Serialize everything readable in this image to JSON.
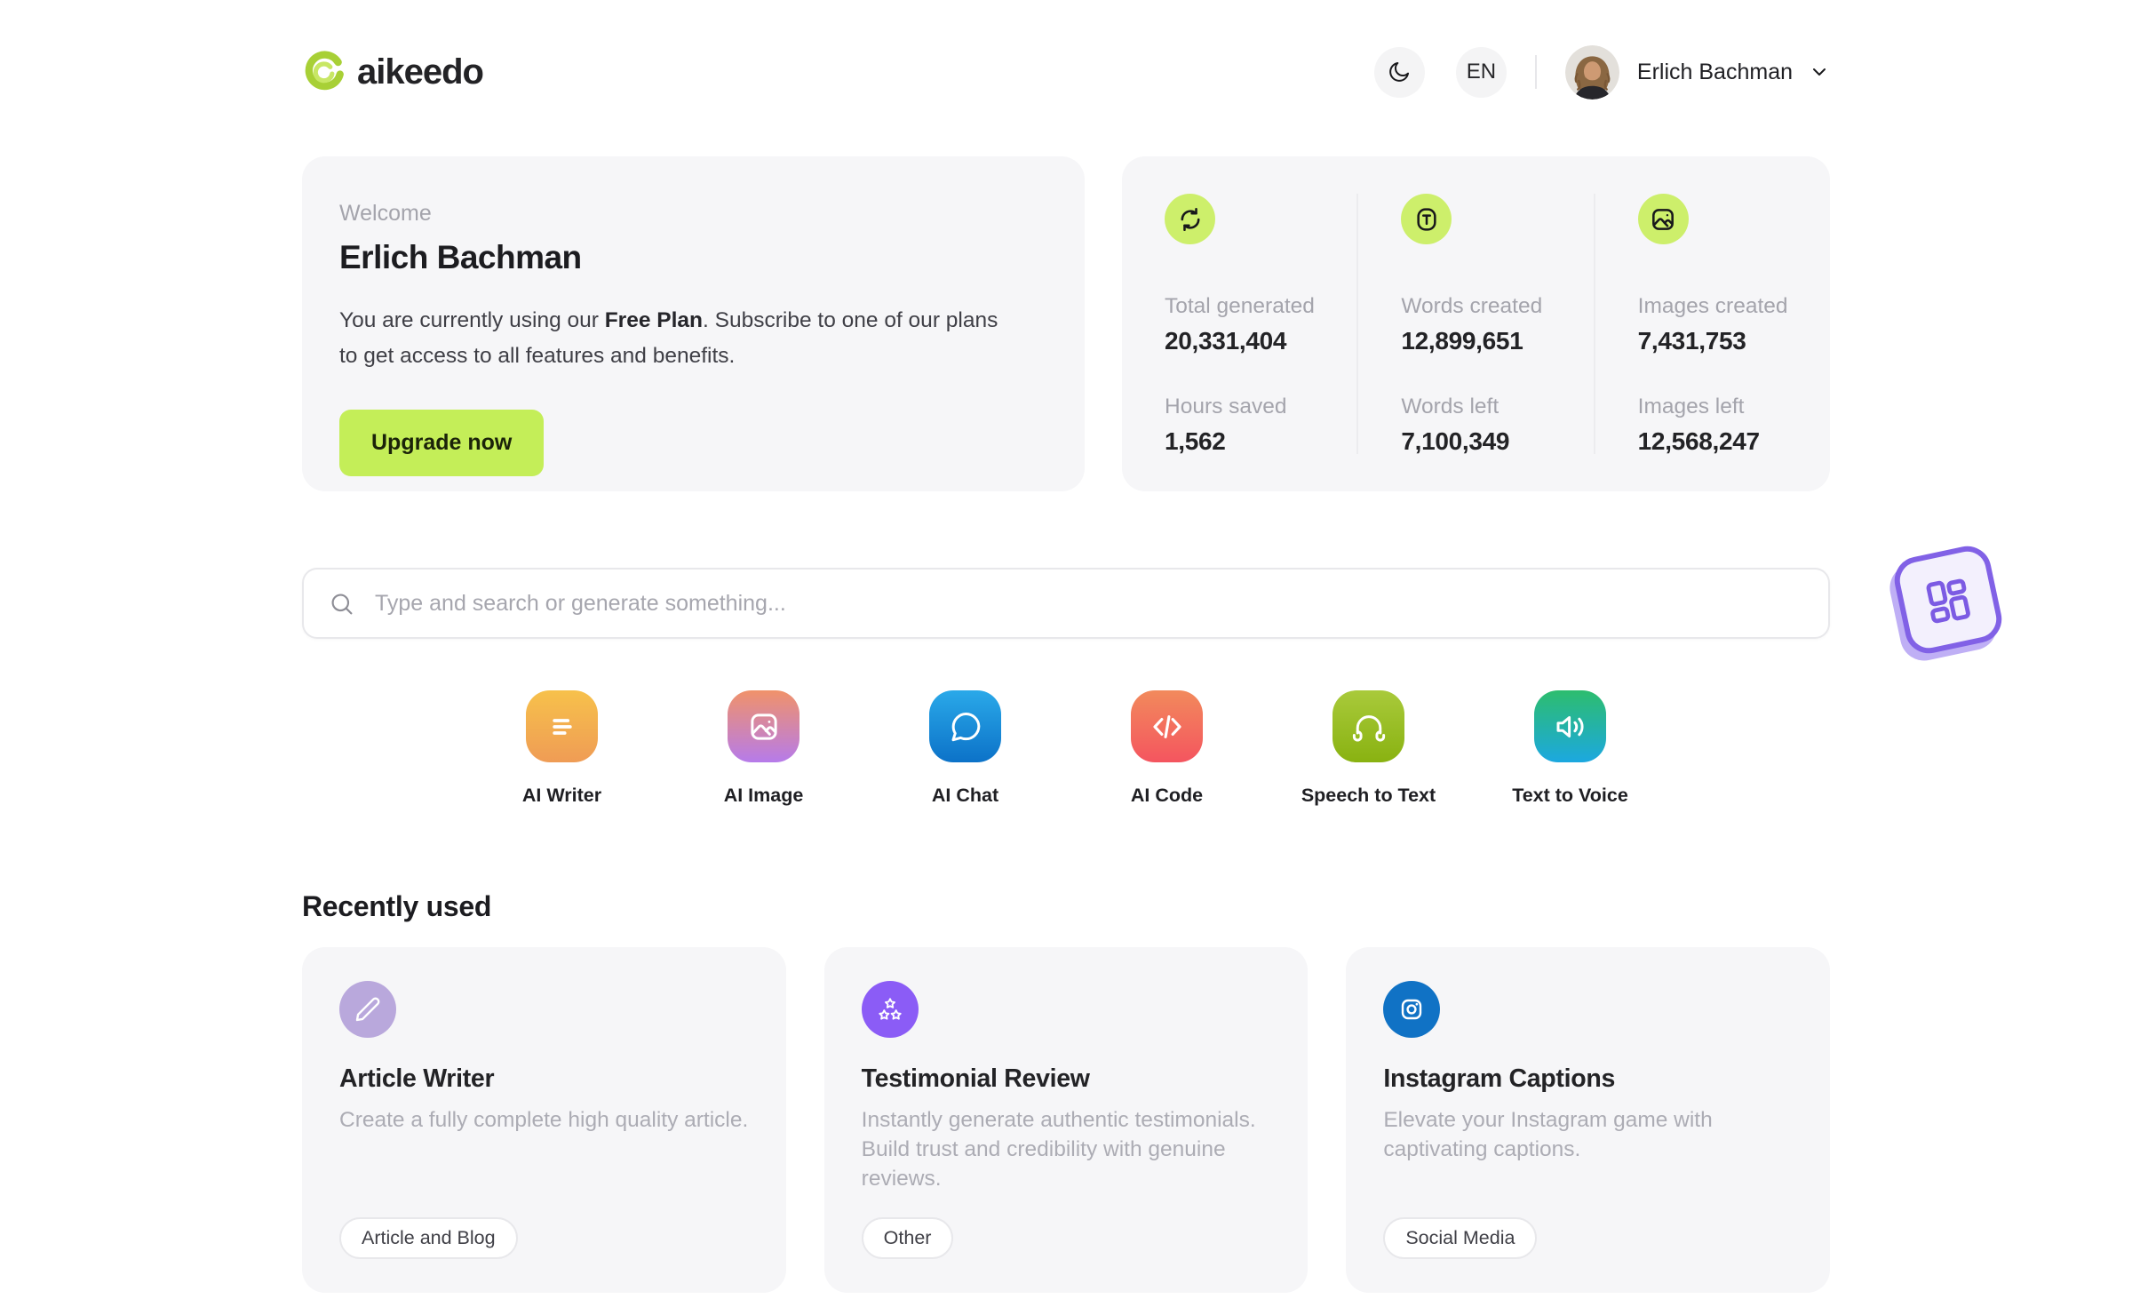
{
  "header": {
    "logo_text": "aikeedo",
    "language": "EN",
    "user_name": "Erlich Bachman"
  },
  "welcome": {
    "eyebrow": "Welcome",
    "name": "Erlich Bachman",
    "message_pre": "You are currently using our ",
    "plan": "Free Plan",
    "message_post": ". Subscribe to one of our plans to get access to all features and benefits.",
    "cta": "Upgrade now"
  },
  "stats": {
    "columns": [
      {
        "icon": "sync-icon",
        "rows": [
          {
            "label": "Total generated",
            "value": "20,331,404"
          },
          {
            "label": "Hours saved",
            "value": "1,562"
          }
        ]
      },
      {
        "icon": "text-icon",
        "rows": [
          {
            "label": "Words created",
            "value": "12,899,651"
          },
          {
            "label": "Words left",
            "value": "7,100,349"
          }
        ]
      },
      {
        "icon": "image-icon",
        "rows": [
          {
            "label": "Images created",
            "value": "7,431,753"
          },
          {
            "label": "Images left",
            "value": "12,568,247"
          }
        ]
      }
    ]
  },
  "search": {
    "placeholder": "Type and search or generate something..."
  },
  "tools": [
    {
      "label": "AI Writer",
      "icon": "writer-icon",
      "gradient": [
        "#F7C14B",
        "#EF9C55"
      ]
    },
    {
      "label": "AI Image",
      "icon": "image-icon",
      "gradient": [
        "#F0926A",
        "#B67BEA"
      ]
    },
    {
      "label": "AI Chat",
      "icon": "chat-icon",
      "gradient": [
        "#2AA9E9",
        "#0C72C8"
      ]
    },
    {
      "label": "AI Code",
      "icon": "code-icon",
      "gradient": [
        "#F28A5C",
        "#F4555F"
      ]
    },
    {
      "label": "Speech to Text",
      "icon": "headphones-icon",
      "gradient": [
        "#A9CA3B",
        "#89B211"
      ]
    },
    {
      "label": "Text to Voice",
      "icon": "speaker-icon",
      "gradient": [
        "#2DBD6E",
        "#1CA8E0"
      ]
    }
  ],
  "recent": {
    "heading": "Recently used",
    "cards": [
      {
        "title": "Article Writer",
        "description": "Create a fully complete high quality article.",
        "tag": "Article and Blog",
        "icon": "pencil-icon",
        "icon_color": "#B9A8DC"
      },
      {
        "title": "Testimonial Review",
        "description": "Instantly generate authentic testimonials. Build trust and credibility with genuine reviews.",
        "tag": "Other",
        "icon": "stars-icon",
        "icon_color": "#8B5CF6"
      },
      {
        "title": "Instagram Captions",
        "description": "Elevate your Instagram game with captivating captions.",
        "tag": "Social Media",
        "icon": "instagram-icon",
        "icon_color": "#1072C5"
      }
    ]
  },
  "colors": {
    "upgrade_button": "#C4EE58",
    "stat_badge": "#CDEF6B",
    "panel_bg": "#F6F6F8",
    "widget_accent": "#8161E6"
  }
}
